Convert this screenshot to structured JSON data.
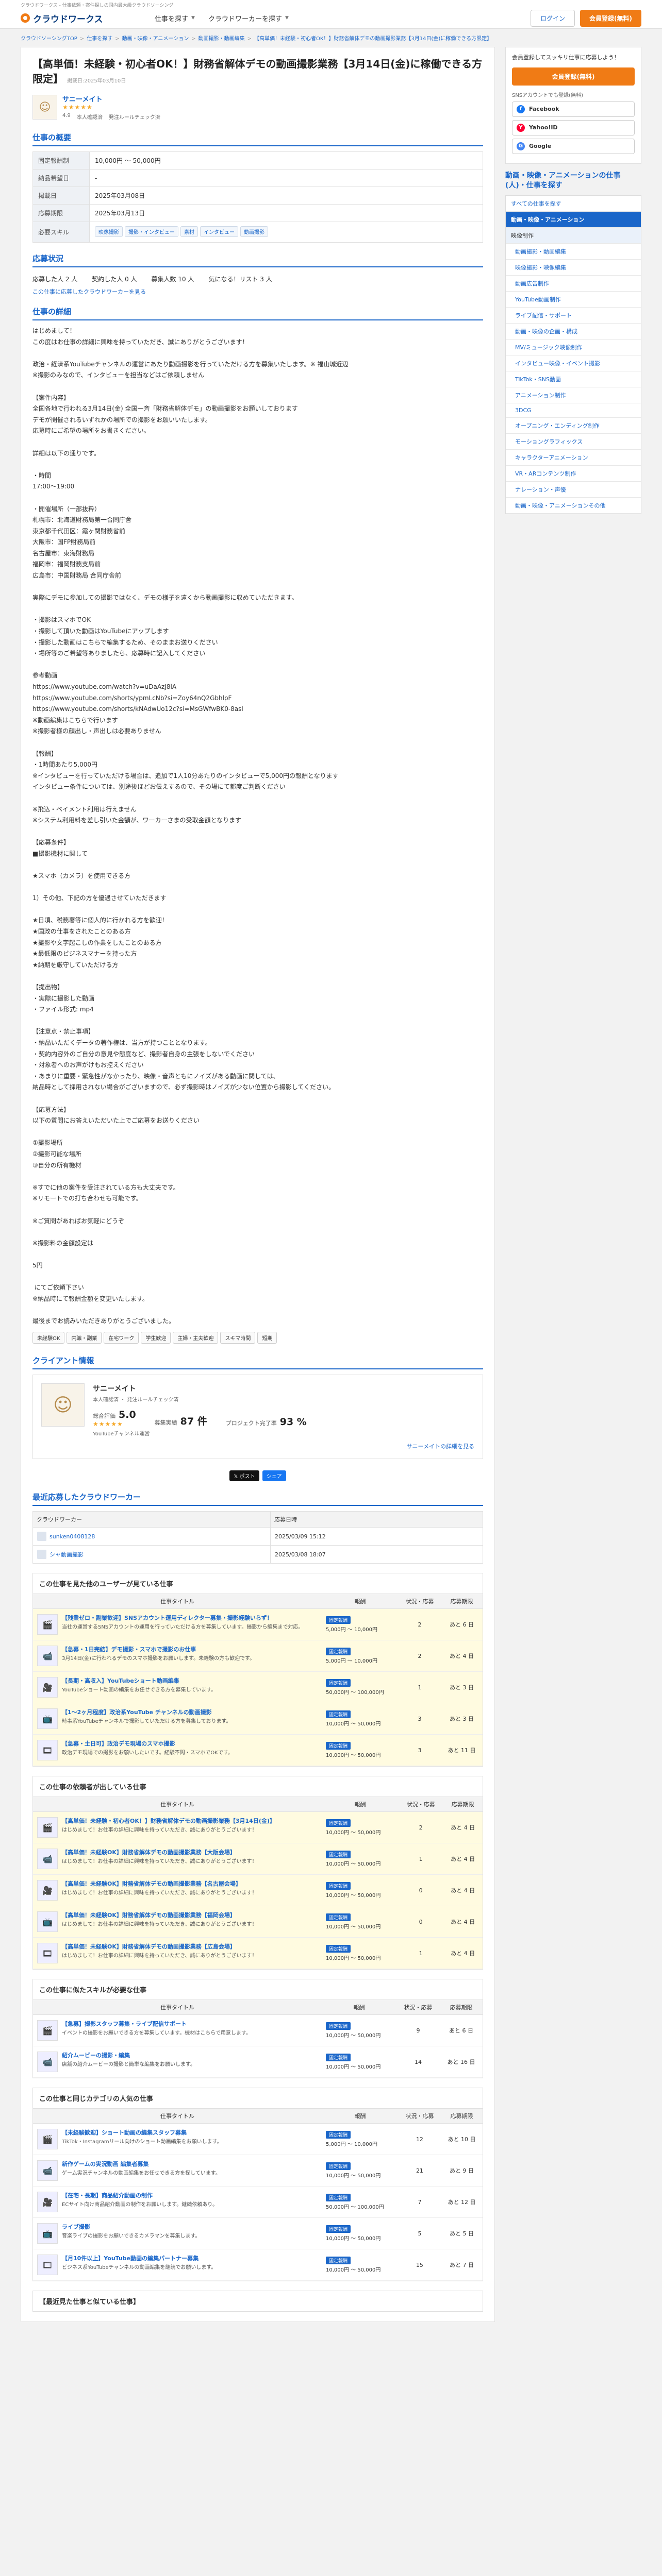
{
  "header": {
    "note": "クラウドワークス - 仕事依頼・案件探しの国内最大級クラウドソーシング",
    "logo": "クラウドワークス",
    "nav_find_work": "仕事を探す",
    "nav_find_worker": "クラウドワーカーを探す",
    "login": "ログイン",
    "signup": "会員登録(無料)"
  },
  "breadcrumb": [
    "クラウドソーシングTOP",
    "仕事を探す",
    "動画・映像・アニメーション",
    "動画撮影・動画編集",
    "【高単価！未経験・初心者OK！】財務省解体デモの動画撮影業務【3月14日(金)に稼働できる方限定】"
  ],
  "job": {
    "title": "【高単価！未経験・初心者OK！】財務省解体デモの動画撮影業務【3月14日(金)に稼働できる方限定】",
    "posted": "掲載日:2025年03月10日",
    "client_name": "サニーメイト",
    "client_stars": "★★★★★",
    "client_meta": [
      "4.9",
      "本人確認済",
      "発注ルールチェック済"
    ]
  },
  "summary": {
    "title": "仕事の概要",
    "rows": [
      {
        "label": "固定報酬制",
        "value": "10,000円 〜 50,000円"
      },
      {
        "label": "納品希望日",
        "value": "-"
      },
      {
        "label": "掲載日",
        "value": "2025年03月08日"
      },
      {
        "label": "応募期限",
        "value": "2025年03月13日"
      },
      {
        "label": "必要スキル",
        "tags": [
          "映像撮影",
          "撮影・インタビュー",
          "素材",
          "インタビュー",
          "動画撮影"
        ]
      }
    ]
  },
  "apply": {
    "title": "応募状況",
    "items": [
      "応募した人 2 人",
      "契約した人 0 人",
      "募集人数 10 人",
      "気になる！リスト 3 人"
    ],
    "link": "この仕事に応募したクラウドワーカーを見る"
  },
  "detail": {
    "title": "仕事の詳細",
    "body": "はじめまして！\nこの度はお仕事の詳細に興味を持っていただき、誠にありがとうございます！\n\n政治・経済系YouTubeチャンネルの運営にあたり動画撮影を行っていただける方を募集いたします。※ 福山城近辺\n※撮影のみなので、インタビューを担当などはご依頼しません\n\n【案件内容】\n全国各地で行われる3月14日(金) 全国一斉「財務省解体デモ」の動画撮影をお願いしております\nデモが開催されるいずれかの場所での撮影をお願いいたします。\n応募時にご希望の場所をお書きください。\n\n詳細は以下の通りです。\n\n・時間\n17:00〜19:00\n\n・開催場所（一部抜粋）\n札幌市：北海道財務局第一合同庁舎\n東京都千代田区：霞ヶ関財務省前\n大阪市：国FP財務局前\n名古屋市：東海財務局\n福岡市：福岡財務支局前\n広島市：中国財務局 合同庁舎前\n\n実際にデモに参加しての撮影ではなく、デモの様子を遠くから動画撮影に収めていただきます。\n\n・撮影はスマホでOK\n・撮影して頂いた動画はYouTubeにアップします\n・撮影した動画はこちらで編集するため、そのままお送りください\n・場所等のご希望等ありましたら、応募時に記入してください\n\n参考動画\nhttps://www.youtube.com/watch?v=uDaAzJ8lA\nhttps://www.youtube.com/shorts/ypmLcNb?si=Zoy64nQ2GbhlpF\nhttps://www.youtube.com/shorts/kNAdwUo12c?si=MsGWfwBK0-8asl\n※動画編集はこちらで行います\n※撮影者様の顔出し・声出しは必要ありません\n\n【報酬】\n・1時間あたり5,000円\n※インタビューを行っていただける場合は、追加で1人10分あたりのインタビューで5,000円の報酬となります\nインタビュー条件については、別途後ほどお伝えするので、その場にて都度ご判断ください\n\n※飛込・ペイメント利用は行えません\n※システム利用料を差し引いた金額が、ワーカーさまの受取金額となります\n\n【応募条件】\n■撮影機材に関して\n\n★スマホ（カメラ）を使用できる方\n\n1）その他、下記の方を優遇させていただきます\n\n★日頃、税務署等に個人的に行かれる方を歓迎！\n★国政の仕事をされたことのある方\n★撮影や文字起こしの作業をしたことのある方\n★最低限のビジネスマナーを持った方\n★納期を厳守していただける方\n\n【提出物】\n・実際に撮影した動画\n・ファイル形式: mp4\n\n【注意点・禁止事項】\n・納品いただくデータの著作権は、当方が持つこととなります。\n・契約内容外のご自分の意見や態度など、撮影者自身の主張をしないでください\n・対象者へのお声がけもお控えください\n・あまりに重要・緊急性がなかったり、映像・音声ともにノイズがある動画に関しては、\n納品時として採用されない場合がございますので、必ず撮影時はノイズが少ない位置から撮影してください。\n\n【応募方法】\n以下の質問にお答えいただいた上でご応募をお送りください\n\n①撮影場所\n②撮影可能な場所\n③自分の所有機材\n\n※すでに他の案件を受注されている方も大丈夫です。\n※リモートでの打ち合わせも可能です。\n\n※ご質問があればお気軽にどうぞ\n\n※撮影料の金額設定は\n\n5円\n\n にてご依頼下さい\n※納品時にて報酬金額を変更いたします。\n\n最後までお読みいただきありがとうございました。"
  },
  "tags_row": [
    "未経験OK",
    "内職・副業",
    "在宅ワーク",
    "学生歓迎",
    "主婦・主夫歓迎",
    "スキマ時間",
    "短期"
  ],
  "client": {
    "title": "クライアント情報",
    "name": "サニーメイト",
    "meta": "本人確認済 ・ 発注ルールチェック済",
    "rating_label": "総合評価",
    "rating": "5.0",
    "stars": "★★★★★",
    "orders_label": "募集実績",
    "orders": "87 件",
    "completion_label": "プロジェクト完了率",
    "completion": "93 %",
    "site": "YouTubeチャンネル運営",
    "more": "サニーメイトの詳細を見る"
  },
  "share": {
    "x": "𝕏 ポスト",
    "fb": "シェア"
  },
  "workers": {
    "title": "最近応募したクラウドワーカー",
    "col_worker": "クラウドワーカー",
    "col_date": "応募日時",
    "rows": [
      {
        "name": "sunken0408128",
        "date": "2025/03/09 15:12"
      },
      {
        "name": "シャ動画撮影",
        "date": "2025/03/08 18:07"
      }
    ]
  },
  "related_blocks": [
    {
      "title": "この仕事を見た他のユーザーが見ている仕事",
      "highlight": true,
      "headers": [
        "仕事タイトル",
        "報酬",
        "状況・応募",
        "応募期限"
      ],
      "items": [
        {
          "name": "【残業ゼロ・副業歓迎】SNSアカウント運用ディレクター募集・撮影経験いらず！",
          "desc": "当社の運営するSNSアカウントの運用を行っていただける方を募集しています。撮影から編集まで対応。",
          "kind": "固定報酬",
          "price": "5,000円 〜 10,000円",
          "status": "2",
          "deadline": "あと 6 日"
        },
        {
          "name": "【急募・1日完結】デモ撮影・スマホで撮影のお仕事",
          "desc": "3月14日(金)に行われるデモのスマホ撮影をお願いします。未経験の方も歓迎です。",
          "kind": "固定報酬",
          "price": "5,000円 〜 10,000円",
          "status": "2",
          "deadline": "あと 4 日"
        },
        {
          "name": "【長期・高収入】YouTubeショート動画編集",
          "desc": "YouTubeショート動画の編集をお任せできる方を募集しています。",
          "kind": "固定報酬",
          "price": "50,000円 〜 100,000円",
          "status": "1",
          "deadline": "あと 3 日"
        },
        {
          "name": "【1〜2ヶ月程度】政治系YouTube チャンネルの動画撮影",
          "desc": "時事系YouTubeチャンネルで撮影していただける方を募集しております。",
          "kind": "固定報酬",
          "price": "10,000円 〜 50,000円",
          "status": "3",
          "deadline": "あと 3 日"
        },
        {
          "name": "【急募・土日可】政治デモ現場のスマホ撮影",
          "desc": "政治デモ現場での撮影をお願いしたいです。経験不問・スマホでOKです。",
          "kind": "固定報酬",
          "price": "10,000円 〜 50,000円",
          "status": "3",
          "deadline": "あと 11 日"
        }
      ]
    },
    {
      "title": "この仕事の依頼者が出している仕事",
      "highlight": true,
      "headers": [
        "仕事タイトル",
        "報酬",
        "状況・応募",
        "応募期限"
      ],
      "items": [
        {
          "name": "【高単価！未経験・初心者OK！】財務省解体デモの動画撮影業務【3月14日(金)】",
          "desc": "はじめまして！お仕事の詳細に興味を持っていただき、誠にありがとうございます！",
          "kind": "固定報酬",
          "price": "10,000円 〜 50,000円",
          "status": "2",
          "deadline": "あと 4 日"
        },
        {
          "name": "【高単価！未経験OK】財務省解体デモの動画撮影業務【大阪会場】",
          "desc": "はじめまして！お仕事の詳細に興味を持っていただき、誠にありがとうございます！",
          "kind": "固定報酬",
          "price": "10,000円 〜 50,000円",
          "status": "1",
          "deadline": "あと 4 日"
        },
        {
          "name": "【高単価！未経験OK】財務省解体デモの動画撮影業務【名古屋会場】",
          "desc": "はじめまして！お仕事の詳細に興味を持っていただき、誠にありがとうございます！",
          "kind": "固定報酬",
          "price": "10,000円 〜 50,000円",
          "status": "0",
          "deadline": "あと 4 日"
        },
        {
          "name": "【高単価！未経験OK】財務省解体デモの動画撮影業務【福岡会場】",
          "desc": "はじめまして！お仕事の詳細に興味を持っていただき、誠にありがとうございます！",
          "kind": "固定報酬",
          "price": "10,000円 〜 50,000円",
          "status": "0",
          "deadline": "あと 4 日"
        },
        {
          "name": "【高単価！未経験OK】財務省解体デモの動画撮影業務【広島会場】",
          "desc": "はじめまして！お仕事の詳細に興味を持っていただき、誠にありがとうございます！",
          "kind": "固定報酬",
          "price": "10,000円 〜 50,000円",
          "status": "1",
          "deadline": "あと 4 日"
        }
      ]
    },
    {
      "title": "この仕事に似たスキルが必要な仕事",
      "highlight": false,
      "headers": [
        "仕事タイトル",
        "報酬",
        "状況・応募",
        "応募期限"
      ],
      "items": [
        {
          "name": "【急募】撮影スタッフ募集・ライブ配信サポート",
          "desc": "イベントの撮影をお願いできる方を募集しています。機材はこちらで用意します。",
          "kind": "固定報酬",
          "price": "10,000円 〜 50,000円",
          "status": "9",
          "deadline": "あと 6 日"
        },
        {
          "name": "紹介ムービーの撮影・編集",
          "desc": "店舗の紹介ムービーの撮影と簡単な編集をお願いします。",
          "kind": "固定報酬",
          "price": "10,000円 〜 50,000円",
          "status": "14",
          "deadline": "あと 16 日"
        }
      ]
    },
    {
      "title": "この仕事と同じカテゴリの人気の仕事",
      "highlight": false,
      "headers": [
        "仕事タイトル",
        "報酬",
        "状況・応募",
        "応募期限"
      ],
      "items": [
        {
          "name": "【未経験歓迎】ショート動画の編集スタッフ募集",
          "desc": "TikTok・Instagramリール向けのショート動画編集をお願いします。",
          "kind": "固定報酬",
          "price": "5,000円 〜 10,000円",
          "status": "12",
          "deadline": "あと 10 日"
        },
        {
          "name": "新作ゲームの実況動画 編集者募集",
          "desc": "ゲーム実況チャンネルの動画編集をお任せできる方を探しています。",
          "kind": "固定報酬",
          "price": "10,000円 〜 50,000円",
          "status": "21",
          "deadline": "あと 9 日"
        },
        {
          "name": "【在宅・長期】商品紹介動画の制作",
          "desc": "ECサイト向け商品紹介動画の制作をお願いします。継続依頼あり。",
          "kind": "固定報酬",
          "price": "50,000円 〜 100,000円",
          "status": "7",
          "deadline": "あと 12 日"
        },
        {
          "name": "ライブ撮影",
          "desc": "音楽ライブの撮影をお願いできるカメラマンを募集します。",
          "kind": "固定報酬",
          "price": "10,000円 〜 50,000円",
          "status": "5",
          "deadline": "あと 5 日"
        },
        {
          "name": "【月10件以上】YouTube動画の編集パートナー募集",
          "desc": "ビジネス系YouTubeチャンネルの動画編集を継続でお願いします。",
          "kind": "固定報酬",
          "price": "10,000円 〜 50,000円",
          "status": "15",
          "deadline": "あと 7 日"
        }
      ]
    }
  ],
  "bottom_title": "【最近見た仕事と似ている仕事】",
  "sidebar": {
    "text": "会員登録してスッキリ仕事に応募しよう！",
    "cta": "会員登録(無料)",
    "sub": "SNSアカウントでも登録(無料)",
    "sns": [
      {
        "label": "Facebook",
        "color": "#1877f2",
        "icon": "f",
        "name": "facebook-icon"
      },
      {
        "label": "Yahoo!ID",
        "color": "#ff0033",
        "icon": "Y",
        "name": "yahoo-icon"
      },
      {
        "label": "Google",
        "color": "#4285f4",
        "icon": "G",
        "name": "google-icon"
      }
    ],
    "cat_title": "動画・映像・アニメーションの仕事(人)・仕事を探す",
    "categories": [
      {
        "label": "すべての仕事を探す",
        "type": "link"
      },
      {
        "label": "動画・映像・アニメーション",
        "type": "head"
      },
      {
        "label": "映像制作",
        "type": "sub"
      },
      {
        "label": "動画撮影・動画編集",
        "type": "sub2"
      },
      {
        "label": "映像撮影・映像編集",
        "type": "sub2"
      },
      {
        "label": "動画広告制作",
        "type": "sub2"
      },
      {
        "label": "YouTube動画制作",
        "type": "sub2"
      },
      {
        "label": "ライブ配信・サポート",
        "type": "sub2"
      },
      {
        "label": "動画・映像の企画・構成",
        "type": "sub2"
      },
      {
        "label": "MV/ミュージック映像制作",
        "type": "sub2"
      },
      {
        "label": "インタビュー映像・イベント撮影",
        "type": "sub2"
      },
      {
        "label": "TikTok・SNS動画",
        "type": "sub2"
      },
      {
        "label": "アニメーション制作",
        "type": "sub2"
      },
      {
        "label": "3DCG",
        "type": "sub2"
      },
      {
        "label": "オープニング・エンディング制作",
        "type": "sub2"
      },
      {
        "label": "モーショングラフィックス",
        "type": "sub2"
      },
      {
        "label": "キャラクターアニメーション",
        "type": "sub2"
      },
      {
        "label": "VR・ARコンテンツ制作",
        "type": "sub2"
      },
      {
        "label": "ナレーション・声優",
        "type": "sub2"
      },
      {
        "label": "動画・映像・アニメーションその他",
        "type": "sub2"
      }
    ]
  }
}
